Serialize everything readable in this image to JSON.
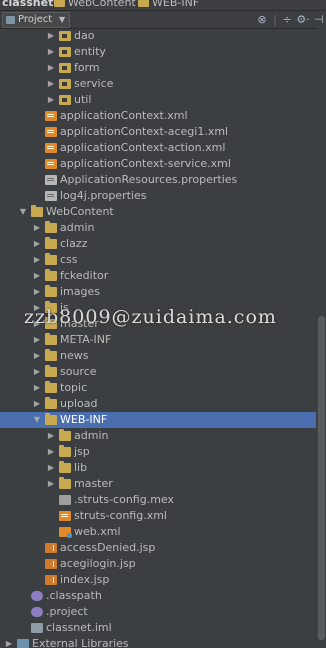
{
  "breadcrumb": {
    "project": "classnet",
    "folder1": "WebContent",
    "folder2": "WEB-INF"
  },
  "toolwindow": {
    "selector_label": "Project",
    "buttons": [
      "sync-icon",
      "divider",
      "collapse-icon",
      "settings-icon",
      "hide-icon"
    ]
  },
  "tree": [
    {
      "label": "dao",
      "icon": "package-icon",
      "expandable": true,
      "expanded": false
    },
    {
      "label": "entity",
      "icon": "package-icon",
      "expandable": true,
      "expanded": false
    },
    {
      "label": "form",
      "icon": "package-icon",
      "expandable": true,
      "expanded": false
    },
    {
      "label": "service",
      "icon": "package-icon",
      "expandable": true,
      "expanded": false
    },
    {
      "label": "util",
      "icon": "package-icon",
      "expandable": true,
      "expanded": false
    },
    {
      "label": "applicationContext.xml",
      "icon": "xml-file-icon",
      "expandable": false
    },
    {
      "label": "applicationContext-acegi1.xml",
      "icon": "xml-file-icon",
      "expandable": false
    },
    {
      "label": "applicationContext-action.xml",
      "icon": "xml-file-icon",
      "expandable": false
    },
    {
      "label": "applicationContext-service.xml",
      "icon": "xml-file-icon",
      "expandable": false
    },
    {
      "label": "ApplicationResources.properties",
      "icon": "properties-file-icon",
      "expandable": false
    },
    {
      "label": "log4j.properties",
      "icon": "properties-file-icon",
      "expandable": false
    },
    {
      "label": "WebContent",
      "icon": "web-folder-icon",
      "expandable": true,
      "expanded": true
    },
    {
      "label": "admin",
      "icon": "folder-icon",
      "expandable": true,
      "expanded": false
    },
    {
      "label": "clazz",
      "icon": "folder-icon",
      "expandable": true,
      "expanded": false
    },
    {
      "label": "css",
      "icon": "folder-icon",
      "expandable": true,
      "expanded": false
    },
    {
      "label": "fckeditor",
      "icon": "folder-icon",
      "expandable": true,
      "expanded": false
    },
    {
      "label": "images",
      "icon": "folder-icon",
      "expandable": true,
      "expanded": false
    },
    {
      "label": "js",
      "icon": "folder-icon",
      "expandable": true,
      "expanded": false
    },
    {
      "label": "master",
      "icon": "folder-icon",
      "expandable": true,
      "expanded": false
    },
    {
      "label": "META-INF",
      "icon": "folder-icon",
      "expandable": true,
      "expanded": false
    },
    {
      "label": "news",
      "icon": "folder-icon",
      "expandable": true,
      "expanded": false
    },
    {
      "label": "source",
      "icon": "folder-icon",
      "expandable": true,
      "expanded": false
    },
    {
      "label": "topic",
      "icon": "folder-icon",
      "expandable": true,
      "expanded": false
    },
    {
      "label": "upload",
      "icon": "folder-icon",
      "expandable": true,
      "expanded": false
    },
    {
      "label": "WEB-INF",
      "icon": "folder-icon",
      "expandable": true,
      "expanded": true,
      "selected": true
    },
    {
      "label": "admin",
      "icon": "folder-icon",
      "expandable": true,
      "expanded": false
    },
    {
      "label": "jsp",
      "icon": "folder-icon",
      "expandable": true,
      "expanded": false
    },
    {
      "label": "lib",
      "icon": "folder-icon",
      "expandable": true,
      "expanded": false
    },
    {
      "label": "master",
      "icon": "folder-icon",
      "expandable": true,
      "expanded": false
    },
    {
      "label": ".struts-config.mex",
      "icon": "mex-file-icon",
      "expandable": false
    },
    {
      "label": "struts-config.xml",
      "icon": "xml-file-icon",
      "expandable": false
    },
    {
      "label": "web.xml",
      "icon": "web-xml-icon",
      "expandable": false
    },
    {
      "label": "accessDenied.jsp",
      "icon": "jsp-file-icon",
      "expandable": false
    },
    {
      "label": "acegilogin.jsp",
      "icon": "jsp-file-icon",
      "expandable": false
    },
    {
      "label": "index.jsp",
      "icon": "jsp-file-icon",
      "expandable": false
    },
    {
      "label": ".classpath",
      "icon": "config-file-icon",
      "expandable": false
    },
    {
      "label": ".project",
      "icon": "config-file-icon",
      "expandable": false
    },
    {
      "label": "classnet.iml",
      "icon": "iml-file-icon",
      "expandable": false
    },
    {
      "label": "External Libraries",
      "icon": "library-icon",
      "expandable": true,
      "expanded": false
    }
  ],
  "watermark": "zzb8009@zuidaima.com",
  "colors": {
    "background": "#3c3f41",
    "selection": "#4b6eaf",
    "text": "#bbbbbb",
    "folder": "#c9a94f",
    "xml": "#e08a2a"
  }
}
